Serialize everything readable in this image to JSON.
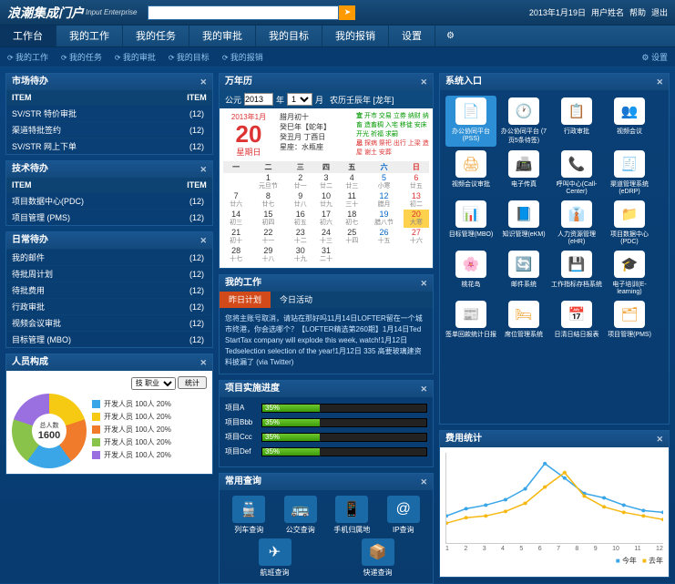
{
  "brand": "浪潮集成门户",
  "brand_sub": "Input Enterprise",
  "search": {
    "placeholder": ""
  },
  "topbar": {
    "date": "2013年1月19日",
    "user": "用户姓名",
    "help": "帮助",
    "logout": "退出"
  },
  "mainnav": [
    "工作台",
    "我的工作",
    "我的任务",
    "我的审批",
    "我的目标",
    "我的报销",
    "设置"
  ],
  "subnav": [
    "我的工作",
    "我的任务",
    "我的审批",
    "我的目标",
    "我的报销"
  ],
  "subnav_set": "设置",
  "panels": {
    "market": {
      "title": "市场待办",
      "cols": [
        "ITEM",
        "ITEM"
      ],
      "rows": [
        [
          "SV/STR 特价审批",
          "(12)"
        ],
        [
          "渠道特批签约",
          "(12)"
        ],
        [
          "SV/STR 网上下单",
          "(12)"
        ]
      ]
    },
    "tech": {
      "title": "技术待办",
      "cols": [
        "ITEM",
        "ITEM"
      ],
      "rows": [
        [
          "项目数据中心(PDC)",
          "(12)"
        ],
        [
          "项目管理 (PMS)",
          "(12)"
        ]
      ]
    },
    "daily": {
      "title": "日常待办",
      "rows": [
        [
          "我的邮件",
          "(12)"
        ],
        [
          "待批周计划",
          "(12)"
        ],
        [
          "待批费用",
          "(12)"
        ],
        [
          "行政审批",
          "(12)"
        ],
        [
          "视频会议审批",
          "(12)"
        ],
        [
          "目标管理 (MBO)",
          "(12)"
        ]
      ]
    },
    "staff": {
      "title": "人员构成",
      "filter_label": "技 职业",
      "btn": "统计",
      "total_label": "总人数",
      "total": "1600",
      "legend": [
        [
          "#3aa6e8",
          "开发人员 100人 20%"
        ],
        [
          "#f6c913",
          "开发人员 100人 20%"
        ],
        [
          "#f07b2a",
          "开发人员 100人 20%"
        ],
        [
          "#8ac34a",
          "开发人员 100人 20%"
        ],
        [
          "#9a6fe0",
          "开发人员 100人 20%"
        ]
      ]
    },
    "calendar": {
      "title": "万年历",
      "era": "公元",
      "year": "2013",
      "yu": "年",
      "month": "1",
      "mu": "月",
      "lunar_y": "农历壬辰年 [龙年]",
      "big": {
        "ym": "2013年1月",
        "d": "20",
        "wd": "星期日"
      },
      "mid": [
        "腊月初十",
        "癸巳年【蛇年】",
        "癸丑月 丁酉日",
        "星座：水瓶座"
      ],
      "yi_label": "宜",
      "yi": "开市 交易 立券 纳财 纳畜 造畜稠 入宅 移徙 安床 开光 祈福 求嗣",
      "ji_label": "忌",
      "ji": "探病 祭祀 出行 上梁 造屋 谢土 安葬",
      "wk": [
        "一",
        "二",
        "三",
        "四",
        "五",
        "六",
        "日"
      ],
      "cells": [
        [
          [
            "",
            "",
            ""
          ],
          [
            "1",
            "元旦节",
            ""
          ],
          [
            "2",
            "廿一",
            ""
          ],
          [
            "3",
            "廿二",
            ""
          ],
          [
            "4",
            "廿三",
            ""
          ],
          [
            "5",
            "小寒",
            "sat"
          ],
          [
            "6",
            "廿五",
            "sun"
          ]
        ],
        [
          [
            "7",
            "廿六",
            ""
          ],
          [
            "8",
            "廿七",
            ""
          ],
          [
            "9",
            "廿八",
            ""
          ],
          [
            "10",
            "廿九",
            ""
          ],
          [
            "11",
            "三十",
            ""
          ],
          [
            "12",
            "腊月",
            "sat"
          ],
          [
            "13",
            "初二",
            "sun"
          ]
        ],
        [
          [
            "14",
            "初三",
            ""
          ],
          [
            "15",
            "初四",
            ""
          ],
          [
            "16",
            "初五",
            ""
          ],
          [
            "17",
            "初六",
            ""
          ],
          [
            "18",
            "初七",
            ""
          ],
          [
            "19",
            "腊八节",
            "sat"
          ],
          [
            "20",
            "大寒",
            "sun today"
          ]
        ],
        [
          [
            "21",
            "初十",
            ""
          ],
          [
            "22",
            "十一",
            ""
          ],
          [
            "23",
            "十二",
            ""
          ],
          [
            "24",
            "十三",
            ""
          ],
          [
            "25",
            "十四",
            ""
          ],
          [
            "26",
            "十五",
            "sat"
          ],
          [
            "27",
            "十六",
            "sun"
          ]
        ],
        [
          [
            "28",
            "十七",
            ""
          ],
          [
            "29",
            "十八",
            ""
          ],
          [
            "30",
            "十九",
            ""
          ],
          [
            "31",
            "二十",
            ""
          ],
          [
            "",
            "",
            ""
          ],
          [
            "",
            "",
            ""
          ],
          [
            "",
            "",
            ""
          ]
        ]
      ]
    },
    "mywork": {
      "title": "我的工作",
      "tabs": [
        "昨日计划",
        "今日活动"
      ],
      "text": "您将主账号取消，请站在那好吗11月14日LOFTER留在一个城市终港，你会选哪个？【LOFTER精选第260期】1月14日Ted StartTax company will explode this week, watch!1月12日Tedselection selection of the year!1月12日 335 高要玻璃建资料披漏了 (via Twitter)"
    },
    "progress": {
      "title": "项目实施进度",
      "rows": [
        [
          "项目A",
          "35%",
          35
        ],
        [
          "项目Bbb",
          "35%",
          35
        ],
        [
          "项目Ccc",
          "35%",
          35
        ],
        [
          "项目Def",
          "35%",
          35
        ]
      ]
    },
    "query": {
      "title": "常用查询",
      "items": [
        [
          "🚆",
          "列车查询"
        ],
        [
          "🚌",
          "公交查询"
        ],
        [
          "📱",
          "手机归属地"
        ],
        [
          "@",
          "IP查询"
        ],
        [
          "✈",
          "航班查询"
        ],
        [
          "📦",
          "快递查询"
        ]
      ]
    },
    "apps": {
      "title": "系统入口",
      "items": [
        [
          "📄",
          "办公协同平台(PSS)",
          "#5aa9e6",
          1
        ],
        [
          "🕐",
          "办公协同平台 (7页5条待签)",
          "#6fc92f",
          0
        ],
        [
          "📋",
          "行政审批",
          "#5aa9e6",
          0
        ],
        [
          "👥",
          "视频会议",
          "#5aa9e6",
          0
        ],
        [
          "🖨",
          "视频会议审批",
          "#f0a030",
          0
        ],
        [
          "📠",
          "电子传真",
          "#5aa9e6",
          0
        ],
        [
          "📞",
          "呼叫中心(Call-Center)",
          "#f0a030",
          0
        ],
        [
          "🧾",
          "渠道管理系统(eDRP)",
          "#5aa9e6",
          0
        ],
        [
          "📊",
          "目标管理(MBO)",
          "#5aa9e6",
          0
        ],
        [
          "📘",
          "知识管理(eKM)",
          "#5aa9e6",
          0
        ],
        [
          "👔",
          "人力资源管理(eHR)",
          "#5aa9e6",
          0
        ],
        [
          "📁",
          "项目数据中心(PDC)",
          "#5aa9e6",
          0
        ],
        [
          "🌸",
          "桃花岛",
          "#e85a9a",
          0
        ],
        [
          "🔄",
          "邮件系统",
          "#6fc92f",
          0
        ],
        [
          "💾",
          "工作指标存档系统",
          "#5aa9e6",
          0
        ],
        [
          "🎓",
          "电子培训(E-learning)",
          "#5aa9e6",
          0
        ],
        [
          "📰",
          "签单回款统计日报",
          "#5aa9e6",
          0
        ],
        [
          "🛏",
          "席位管理系统",
          "#f0a030",
          0
        ],
        [
          "📅",
          "日清日结日报表",
          "#5aa9e6",
          0
        ],
        [
          "🗂",
          "项目管理(PMS)",
          "#f0a030",
          0
        ]
      ]
    },
    "cost": {
      "title": "费用统计",
      "x": [
        "1",
        "2",
        "3",
        "4",
        "5",
        "6",
        "7",
        "8",
        "9",
        "10",
        "11",
        "12"
      ],
      "legend": [
        "今年",
        "去年"
      ]
    }
  },
  "chart_data": [
    {
      "type": "pie",
      "title": "人员构成",
      "series": [
        {
          "name": "开发人员",
          "value": 20
        },
        {
          "name": "开发人员",
          "value": 20
        },
        {
          "name": "开发人员",
          "value": 20
        },
        {
          "name": "开发人员",
          "value": 20
        },
        {
          "name": "开发人员",
          "value": 20
        }
      ],
      "total": 1600
    },
    {
      "type": "bar",
      "title": "项目实施进度",
      "categories": [
        "项目A",
        "项目Bbb",
        "项目Ccc",
        "项目Def"
      ],
      "values": [
        35,
        35,
        35,
        35
      ],
      "ylim": [
        0,
        100
      ]
    },
    {
      "type": "line",
      "title": "费用统计",
      "x": [
        1,
        2,
        3,
        4,
        5,
        6,
        7,
        8,
        9,
        10,
        11,
        12
      ],
      "series": [
        {
          "name": "今年",
          "values": [
            30,
            38,
            42,
            48,
            60,
            88,
            72,
            55,
            50,
            42,
            36,
            34
          ]
        },
        {
          "name": "去年",
          "values": [
            22,
            28,
            30,
            35,
            44,
            62,
            78,
            52,
            40,
            34,
            30,
            26
          ]
        }
      ],
      "ylim": [
        0,
        100
      ]
    }
  ]
}
